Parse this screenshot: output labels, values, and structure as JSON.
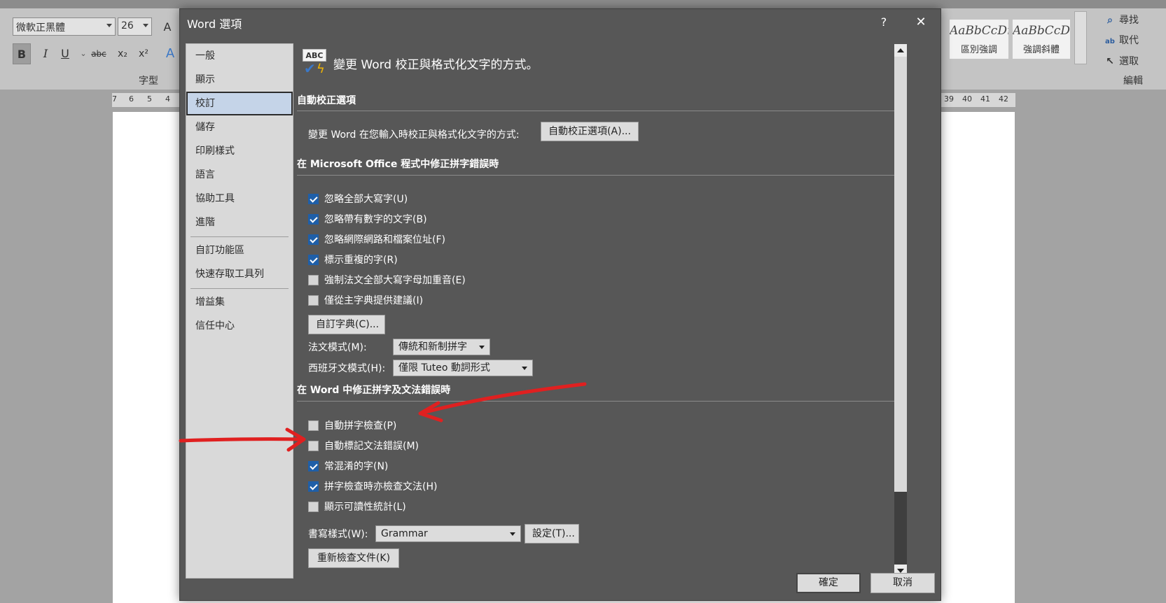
{
  "ribbon": {
    "font_name": "微軟正黑體",
    "font_size": "26",
    "grow_font": "A",
    "bold": "B",
    "italic": "I",
    "underline": "U",
    "strike": "abc",
    "subscript": "x₂",
    "superscript": "x²",
    "text_effects": "A",
    "font_group_label": "字型",
    "styles": [
      {
        "sample": "AaBbCcDı",
        "name": "區別強調"
      },
      {
        "sample": "AaBbCcDı",
        "name": "強調斜體"
      }
    ],
    "find": "尋找",
    "replace": "取代",
    "select": "選取",
    "editing_group_label": "編輯"
  },
  "ruler": {
    "left_numbers": [
      "7",
      "6",
      "5",
      "4"
    ],
    "right_numbers": [
      "39",
      "40",
      "41",
      "42"
    ]
  },
  "dialog": {
    "title": "Word 選項",
    "help": "?",
    "close": "✕",
    "nav": [
      "一般",
      "顯示",
      "校訂",
      "儲存",
      "印刷樣式",
      "語言",
      "協助工具",
      "進階",
      "自訂功能區",
      "快速存取工具列",
      "增益集",
      "信任中心"
    ],
    "selected_nav": "校訂",
    "header_icon_text": "ABC",
    "header": "變更 Word 校正與格式化文字的方式。",
    "autocorrect": {
      "title": "自動校正選項",
      "desc": "變更 Word 在您輸入時校正與格式化文字的方式:",
      "button": "自動校正選項(A)..."
    },
    "office": {
      "title": "在 Microsoft Office 程式中修正拼字錯誤時",
      "options": [
        {
          "label": "忽略全部大寫字(U)",
          "checked": true
        },
        {
          "label": "忽略帶有數字的文字(B)",
          "checked": true
        },
        {
          "label": "忽略網際網路和檔案位址(F)",
          "checked": true
        },
        {
          "label": "標示重複的字(R)",
          "checked": true
        },
        {
          "label": "強制法文全部大寫字母加重音(E)",
          "checked": false
        },
        {
          "label": "僅從主字典提供建議(I)",
          "checked": false
        }
      ],
      "custom_dict": "自訂字典(C)...",
      "french_label": "法文模式(M):",
      "french_value": "傳統和新制拼字",
      "spanish_label": "西班牙文模式(H):",
      "spanish_value": "僅限 Tuteo 動詞形式"
    },
    "word": {
      "title": "在 Word 中修正拼字及文法錯誤時",
      "options": [
        {
          "label": "自動拼字檢查(P)",
          "checked": false
        },
        {
          "label": "自動標記文法錯誤(M)",
          "checked": false
        },
        {
          "label": "常混淆的字(N)",
          "checked": true
        },
        {
          "label": "拼字檢查時亦檢查文法(H)",
          "checked": true
        },
        {
          "label": "顯示可讀性統計(L)",
          "checked": false
        }
      ],
      "style_label": "書寫樣式(W):",
      "style_value": "Grammar",
      "settings": "設定(T)...",
      "recheck": "重新檢查文件(K)"
    },
    "ok": "確定",
    "cancel": "取消"
  },
  "colors": {
    "dialog_bg": "#575757",
    "nav_bg": "#d9d9d9",
    "nav_selected": "#c5d4e8",
    "checkbox_on": "#1f5fa8",
    "annotation_arrow": "#e02020"
  }
}
